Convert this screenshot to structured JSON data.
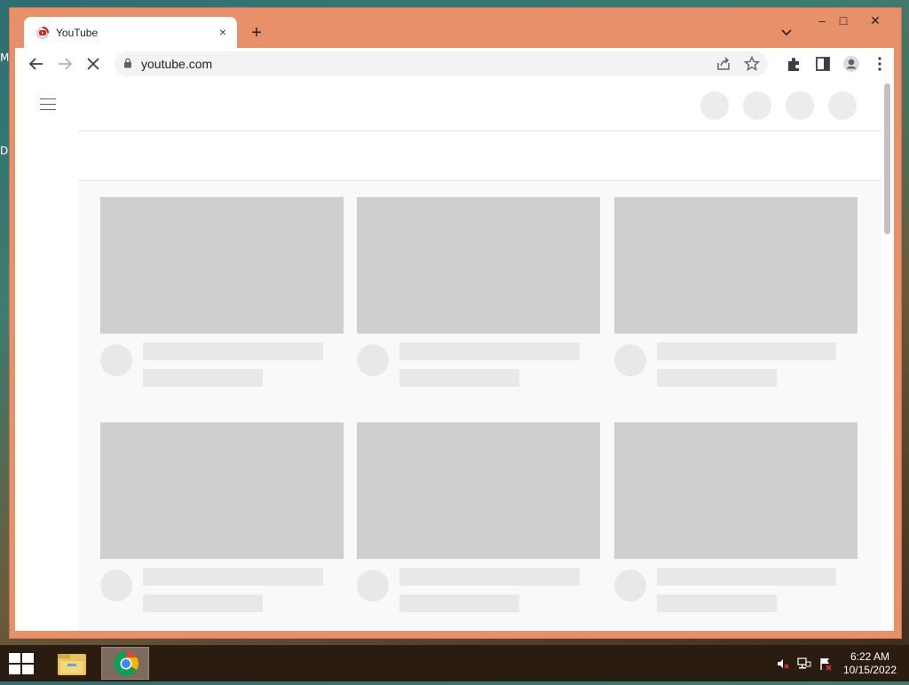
{
  "desktop": {
    "label_m": "M",
    "label_d": "D"
  },
  "browser": {
    "tab": {
      "title": "YouTube",
      "close_label": "×"
    },
    "new_tab_label": "+",
    "window_controls": {
      "minimize": "–",
      "maximize": "□",
      "close": "✕"
    },
    "address": {
      "url": "youtube.com"
    }
  },
  "page": {
    "video_grid": [
      {
        "row": 1,
        "cards": 3
      },
      {
        "row": 2,
        "cards": 3
      }
    ]
  },
  "taskbar": {
    "clock": {
      "time": "6:22 AM",
      "date": "10/15/2022"
    }
  },
  "colors": {
    "window_frame": "#e8906a",
    "placeholder_thumb": "#cfcfcf",
    "placeholder_line": "#e8e8e8"
  }
}
